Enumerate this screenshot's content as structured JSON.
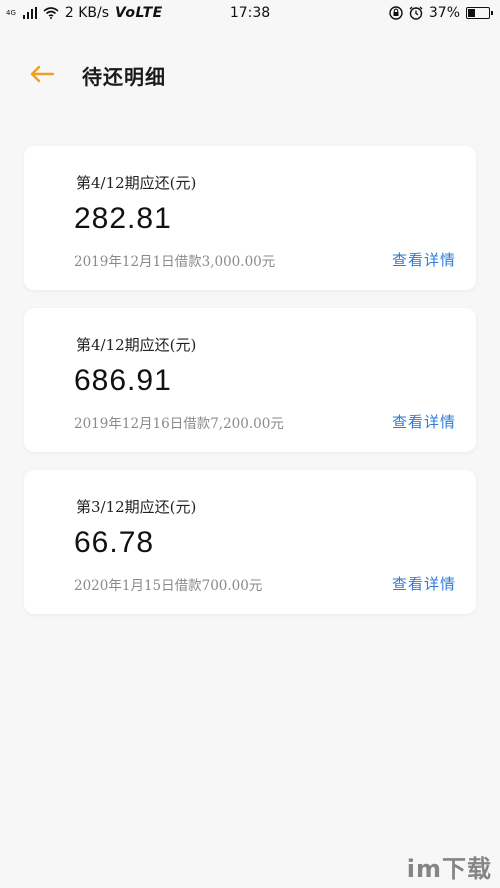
{
  "status_bar": {
    "network": "4G",
    "speed": "2 KB/s",
    "volte": "VoLTE",
    "time": "17:38",
    "battery_percent": "37%",
    "battery_level": 0.37
  },
  "header": {
    "title": "待还明细"
  },
  "colors": {
    "accent_back": "#f0a020",
    "link": "#2d7cd6"
  },
  "cards": [
    {
      "period": "第4/12期应还(元)",
      "amount": "282.81",
      "description": "2019年12月1日借款3,000.00元",
      "link": "查看详情"
    },
    {
      "period": "第4/12期应还(元)",
      "amount": "686.91",
      "description": "2019年12月16日借款7,200.00元",
      "link": "查看详情"
    },
    {
      "period": "第3/12期应还(元)",
      "amount": "66.78",
      "description": "2020年1月15日借款700.00元",
      "link": "查看详情"
    }
  ],
  "watermark": "im下载"
}
